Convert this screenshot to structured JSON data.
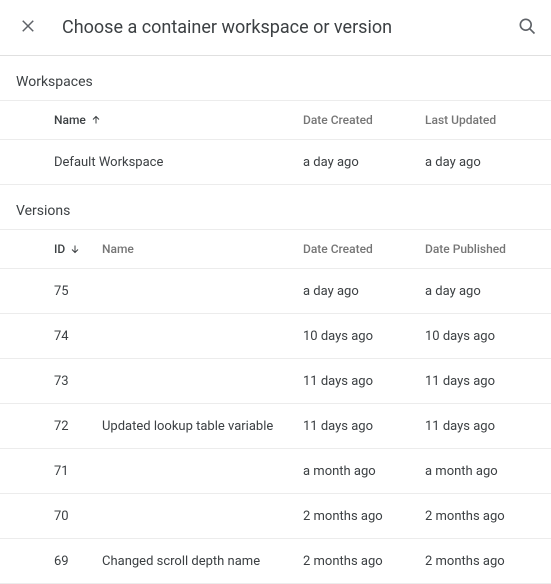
{
  "header": {
    "title": "Choose a container workspace or version"
  },
  "workspaces": {
    "heading": "Workspaces",
    "columns": {
      "name": "Name",
      "created": "Date Created",
      "updated": "Last Updated"
    },
    "rows": [
      {
        "name": "Default Workspace",
        "created": "a day ago",
        "updated": "a day ago"
      }
    ]
  },
  "versions": {
    "heading": "Versions",
    "columns": {
      "id": "ID",
      "name": "Name",
      "created": "Date Created",
      "published": "Date Published"
    },
    "rows": [
      {
        "id": "75",
        "name": "",
        "created": "a day ago",
        "published": "a day ago"
      },
      {
        "id": "74",
        "name": "",
        "created": "10 days ago",
        "published": "10 days ago"
      },
      {
        "id": "73",
        "name": "",
        "created": "11 days ago",
        "published": "11 days ago"
      },
      {
        "id": "72",
        "name": "Updated lookup table variable",
        "created": "11 days ago",
        "published": "11 days ago"
      },
      {
        "id": "71",
        "name": "",
        "created": "a month ago",
        "published": "a month ago"
      },
      {
        "id": "70",
        "name": "",
        "created": "2 months ago",
        "published": "2 months ago"
      },
      {
        "id": "69",
        "name": "Changed scroll depth name",
        "created": "2 months ago",
        "published": "2 months ago"
      }
    ]
  }
}
